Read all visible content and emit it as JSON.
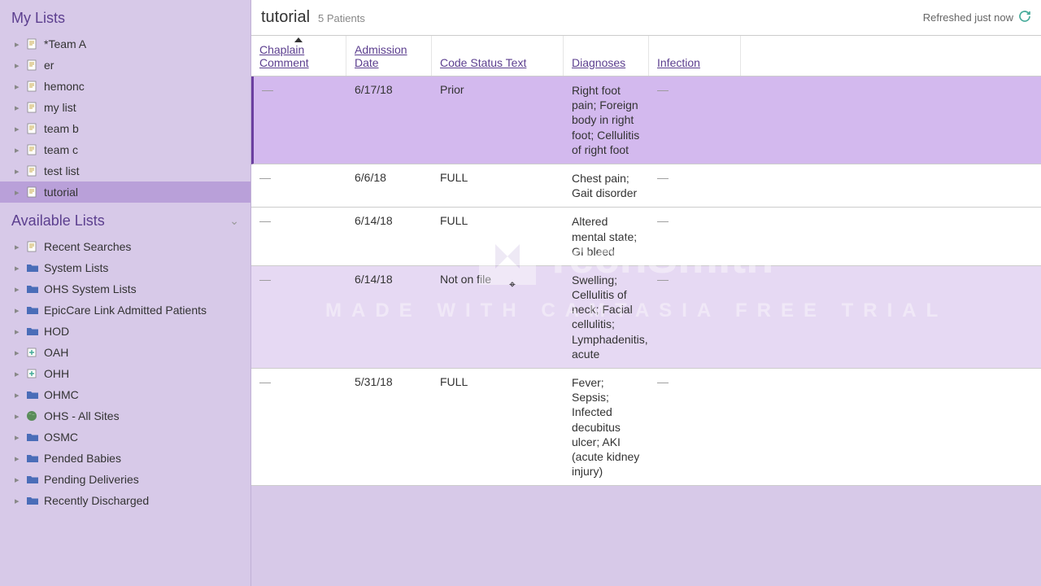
{
  "sidebar": {
    "my_lists_title": "My Lists",
    "my_lists": [
      {
        "label": "*Team A",
        "icon": "doc"
      },
      {
        "label": "er",
        "icon": "doc"
      },
      {
        "label": "hemonc",
        "icon": "doc"
      },
      {
        "label": "my list",
        "icon": "doc"
      },
      {
        "label": "team b",
        "icon": "doc"
      },
      {
        "label": "team c",
        "icon": "doc"
      },
      {
        "label": "test list",
        "icon": "doc"
      },
      {
        "label": "tutorial",
        "icon": "doc",
        "selected": true
      }
    ],
    "available_title": "Available Lists",
    "available_lists": [
      {
        "label": "Recent Searches",
        "icon": "doc"
      },
      {
        "label": "System Lists",
        "icon": "folder"
      },
      {
        "label": "OHS System Lists",
        "icon": "folder"
      },
      {
        "label": "EpicCare Link Admitted Patients",
        "icon": "folder"
      },
      {
        "label": "HOD",
        "icon": "folder"
      },
      {
        "label": "OAH",
        "icon": "plus"
      },
      {
        "label": "OHH",
        "icon": "plus"
      },
      {
        "label": "OHMC",
        "icon": "folder"
      },
      {
        "label": "OHS - All Sites",
        "icon": "globe"
      },
      {
        "label": "OSMC",
        "icon": "folder"
      },
      {
        "label": "Pended Babies",
        "icon": "folder"
      },
      {
        "label": "Pending Deliveries",
        "icon": "folder"
      },
      {
        "label": "Recently Discharged",
        "icon": "folder"
      }
    ]
  },
  "header": {
    "title": "tutorial",
    "count": "5 Patients",
    "refreshed": "Refreshed just now"
  },
  "columns": {
    "chaplain": "Chaplain Comment",
    "admission": "Admission Date",
    "code": "Code Status Text",
    "diagnoses": "Diagnoses",
    "infection": "Infection"
  },
  "rows": [
    {
      "chaplain": "—",
      "admission": "6/17/18",
      "code": "Prior",
      "diagnoses": "Right foot pain; Foreign body in right foot; Cellulitis of right foot",
      "infection": "—",
      "sel": true
    },
    {
      "chaplain": "—",
      "admission": "6/6/18",
      "code": "FULL",
      "diagnoses": "Chest pain; Gait disorder",
      "infection": "—"
    },
    {
      "chaplain": "—",
      "admission": "6/14/18",
      "code": "FULL",
      "diagnoses": "Altered mental state; GI bleed",
      "infection": "—"
    },
    {
      "chaplain": "—",
      "admission": "6/14/18",
      "code": "Not on file",
      "diagnoses": "Swelling; Cellulitis of neck; Facial cellulitis; Lymphadenitis, acute",
      "infection": "—",
      "hover": true
    },
    {
      "chaplain": "—",
      "admission": "5/31/18",
      "code": "FULL",
      "diagnoses": "Fever; Sepsis; Infected decubitus ulcer; AKI (acute kidney injury)",
      "infection": "—"
    }
  ],
  "watermark": {
    "brand": "TechSmith",
    "sub": "MADE WITH CAMTASIA FREE TRIAL"
  }
}
